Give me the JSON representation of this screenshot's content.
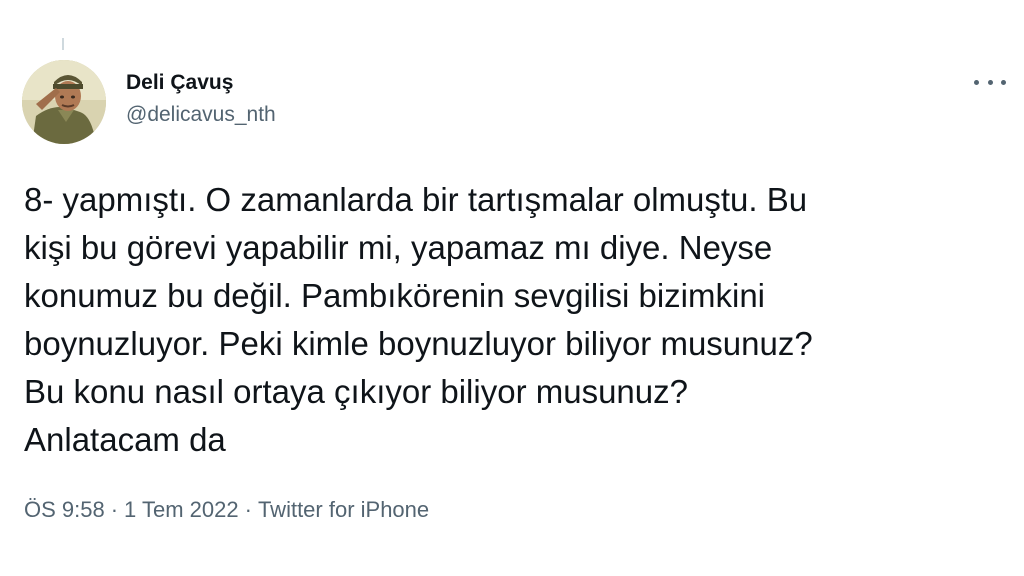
{
  "tweet": {
    "author": {
      "display_name": "Deli Çavuş",
      "handle": "@delicavus_nth",
      "avatar_icon": "saluting-soldier-photo"
    },
    "more_icon": "ellipsis-icon",
    "lines": [
      "8- yapmıştı. O zamanlarda bir tartışmalar olmuştu. Bu",
      "kişi bu görevi yapabilir mi, yapamaz mı diye. Neyse",
      "konumuz bu değil. Pambıkörenin sevgilisi bizimkini",
      "boynuzluyor. Peki kimle boynuzluyor biliyor musunuz?",
      "Bu konu nasıl ortaya çıkıyor biliyor musunuz?",
      "Anlatacam da"
    ],
    "meta": {
      "time": "ÖS 9:58",
      "separator": "·",
      "date": "1 Tem 2022",
      "source": "Twitter for iPhone"
    }
  },
  "colors": {
    "text": "#0f1419",
    "secondary": "#536471",
    "background": "#ffffff"
  }
}
